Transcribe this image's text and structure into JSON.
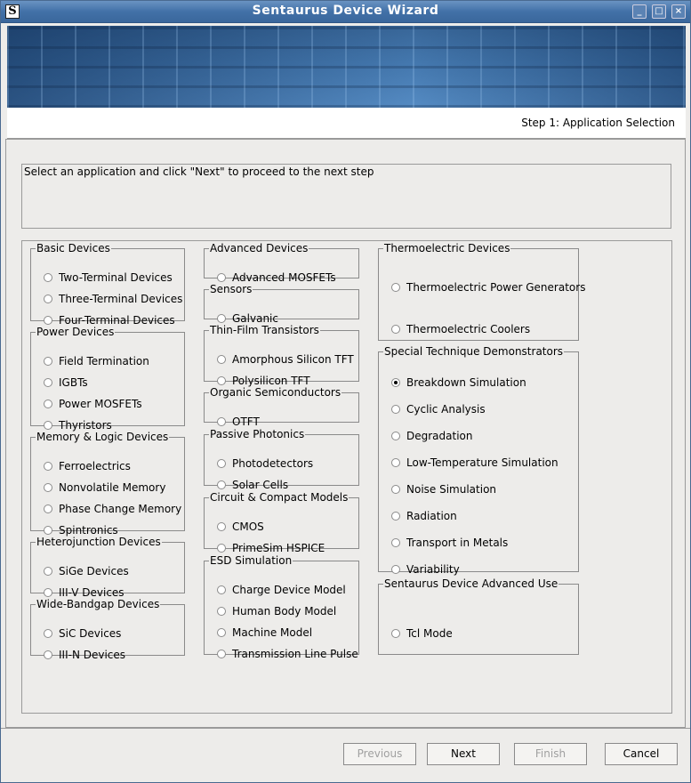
{
  "window": {
    "title": "Sentaurus Device Wizard",
    "app_icon": "S"
  },
  "header": {
    "step": "Step 1: Application Selection"
  },
  "instructions": "Select an application and click \"Next\" to proceed to the next step",
  "groups": [
    {
      "legend": "Basic Devices",
      "options": [
        "Two-Terminal Devices",
        "Three-Terminal Devices",
        "Four-Terminal Devices"
      ]
    },
    {
      "legend": "Power Devices",
      "options": [
        "Field Termination",
        "IGBTs",
        "Power MOSFETs",
        "Thyristors"
      ]
    },
    {
      "legend": "Memory & Logic Devices",
      "options": [
        "Ferroelectrics",
        "Nonvolatile Memory",
        "Phase Change Memory",
        "Spintronics"
      ]
    },
    {
      "legend": "Heterojunction Devices",
      "options": [
        "SiGe Devices",
        "III-V Devices"
      ]
    },
    {
      "legend": "Wide-Bandgap Devices",
      "options": [
        "SiC Devices",
        "III-N Devices"
      ]
    },
    {
      "legend": "Advanced Devices",
      "options": [
        "Advanced MOSFETs"
      ]
    },
    {
      "legend": "Sensors",
      "options": [
        "Galvanic"
      ]
    },
    {
      "legend": "Thin-Film Transistors",
      "options": [
        "Amorphous Silicon TFT",
        "Polysilicon TFT"
      ]
    },
    {
      "legend": "Organic Semiconductors",
      "options": [
        "OTFT"
      ]
    },
    {
      "legend": "Passive Photonics",
      "options": [
        "Photodetectors",
        "Solar Cells"
      ]
    },
    {
      "legend": "Circuit & Compact Models",
      "options": [
        "CMOS",
        "PrimeSim HSPICE"
      ]
    },
    {
      "legend": "ESD Simulation",
      "options": [
        "Charge Device Model",
        "Human Body Model",
        "Machine Model",
        "Transmission Line Pulse"
      ]
    },
    {
      "legend": "Thermoelectric Devices",
      "options": [
        "Thermoelectric Power Generators",
        "Thermoelectric Coolers"
      ]
    },
    {
      "legend": "Special Technique Demonstrators",
      "options": [
        "Breakdown Simulation",
        "Cyclic Analysis",
        "Degradation",
        "Low-Temperature Simulation",
        "Noise Simulation",
        "Radiation",
        "Transport in Metals",
        "Variability"
      ]
    },
    {
      "legend": "Sentaurus Device Advanced Use",
      "options": [
        "Tcl Mode"
      ]
    }
  ],
  "selected": "Breakdown Simulation",
  "buttons": {
    "previous": "Previous",
    "next": "Next",
    "finish": "Finish",
    "cancel": "Cancel"
  }
}
